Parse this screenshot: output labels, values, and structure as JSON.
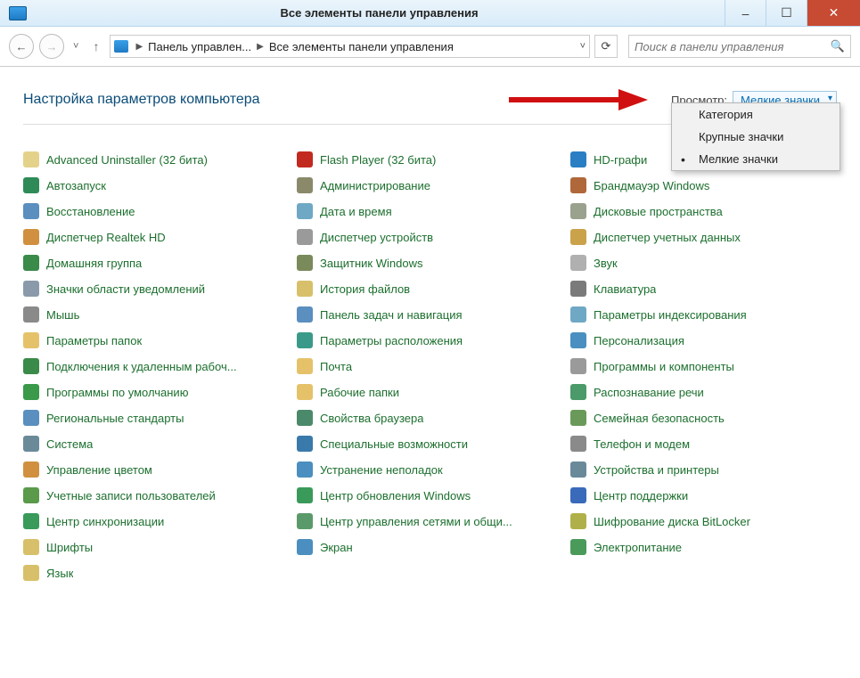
{
  "window": {
    "title": "Все элементы панели управления",
    "minimize": "–",
    "maximize": "☐",
    "close": "✕"
  },
  "nav": {
    "back_glyph": "←",
    "forward_glyph": "→",
    "history_glyph": "˅",
    "up_glyph": "↑",
    "refresh_glyph": "⟳",
    "search_glyph": "🔍"
  },
  "breadcrumb": {
    "item1": "Панель управлен...",
    "item2": "Все элементы панели управления",
    "sep": "▶",
    "drop": "˅"
  },
  "search": {
    "placeholder": "Поиск в панели управления"
  },
  "heading": "Настройка параметров компьютера",
  "view": {
    "label": "Просмотр:",
    "selected": "Мелкие значки",
    "options": {
      "category": "Категория",
      "large": "Крупные значки",
      "small": "Мелкие значки"
    }
  },
  "items": [
    {
      "label": "Advanced Uninstaller (32 бита)",
      "iconColor": "#e5d28a"
    },
    {
      "label": "Flash Player (32 бита)",
      "iconColor": "#c22a1f"
    },
    {
      "label": "HD-графи",
      "iconColor": "#2a7ec4"
    },
    {
      "label": "Автозапуск",
      "iconColor": "#2e8b57"
    },
    {
      "label": "Администрирование",
      "iconColor": "#8a8a6a"
    },
    {
      "label": "Брандмауэр Windows",
      "iconColor": "#b0683a"
    },
    {
      "label": "Восстановление",
      "iconColor": "#5a8fbf"
    },
    {
      "label": "Дата и время",
      "iconColor": "#6fa8c4"
    },
    {
      "label": "Дисковые пространства",
      "iconColor": "#9aa18d"
    },
    {
      "label": "Диспетчер Realtek HD",
      "iconColor": "#d09040"
    },
    {
      "label": "Диспетчер устройств",
      "iconColor": "#9a9a9a"
    },
    {
      "label": "Диспетчер учетных данных",
      "iconColor": "#caa24a"
    },
    {
      "label": "Домашняя группа",
      "iconColor": "#3a8a4a"
    },
    {
      "label": "Защитник Windows",
      "iconColor": "#7a8a5a"
    },
    {
      "label": "Звук",
      "iconColor": "#b0b0b0"
    },
    {
      "label": "Значки области уведомлений",
      "iconColor": "#8a9aaa"
    },
    {
      "label": "История файлов",
      "iconColor": "#d8c06a"
    },
    {
      "label": "Клавиатура",
      "iconColor": "#7a7a7a"
    },
    {
      "label": "Мышь",
      "iconColor": "#8a8a8a"
    },
    {
      "label": "Панель задач и навигация",
      "iconColor": "#5a8fbf"
    },
    {
      "label": "Параметры индексирования",
      "iconColor": "#6fa8c4"
    },
    {
      "label": "Параметры папок",
      "iconColor": "#e5c26a"
    },
    {
      "label": "Параметры расположения",
      "iconColor": "#3a9a8a"
    },
    {
      "label": "Персонализация",
      "iconColor": "#4a8fbf"
    },
    {
      "label": "Подключения к удаленным рабоч...",
      "iconColor": "#3a8a4a"
    },
    {
      "label": "Почта",
      "iconColor": "#e5c26a"
    },
    {
      "label": "Программы и компоненты",
      "iconColor": "#9a9a9a"
    },
    {
      "label": "Программы по умолчанию",
      "iconColor": "#3a9a4a"
    },
    {
      "label": "Рабочие папки",
      "iconColor": "#e5c26a"
    },
    {
      "label": "Распознавание речи",
      "iconColor": "#4a9a6a"
    },
    {
      "label": "Региональные стандарты",
      "iconColor": "#5a8fbf"
    },
    {
      "label": "Свойства браузера",
      "iconColor": "#4a8a6a"
    },
    {
      "label": "Семейная безопасность",
      "iconColor": "#6a9a5a"
    },
    {
      "label": "Система",
      "iconColor": "#6a8a9a"
    },
    {
      "label": "Специальные возможности",
      "iconColor": "#3a7aaa"
    },
    {
      "label": "Телефон и модем",
      "iconColor": "#8a8a8a"
    },
    {
      "label": "Управление цветом",
      "iconColor": "#d09040"
    },
    {
      "label": "Устранение неполадок",
      "iconColor": "#4a8fbf"
    },
    {
      "label": "Устройства и принтеры",
      "iconColor": "#6a8a9a"
    },
    {
      "label": "Учетные записи пользователей",
      "iconColor": "#5a9a4a"
    },
    {
      "label": "Центр обновления Windows",
      "iconColor": "#3a9a5a"
    },
    {
      "label": "Центр поддержки",
      "iconColor": "#3a6aba"
    },
    {
      "label": "Центр синхронизации",
      "iconColor": "#3a9a5a"
    },
    {
      "label": "Центр управления сетями и общи...",
      "iconColor": "#5a9a6a"
    },
    {
      "label": "Шифрование диска BitLocker",
      "iconColor": "#b0b04a"
    },
    {
      "label": "Шрифты",
      "iconColor": "#d8c06a"
    },
    {
      "label": "Экран",
      "iconColor": "#4a8fbf"
    },
    {
      "label": "Электропитание",
      "iconColor": "#4a9a5a"
    },
    {
      "label": "Язык",
      "iconColor": "#d8c06a"
    }
  ]
}
